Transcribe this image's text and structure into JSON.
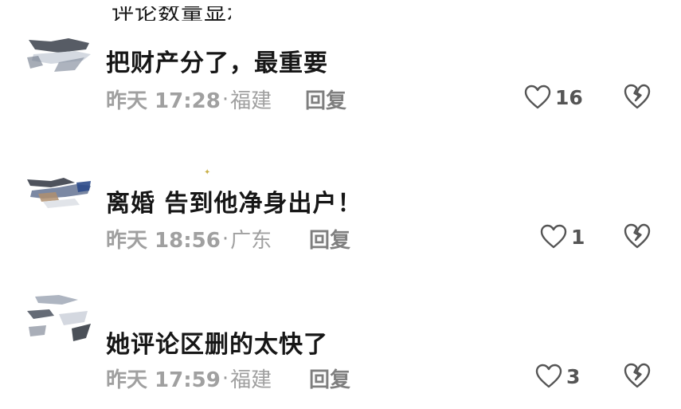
{
  "top_fragment": "评论数量显示",
  "comments": [
    {
      "text": "把财产分了，最重要",
      "time": "昨天 17:28",
      "region": "福建",
      "reply_label": "回复",
      "likes": "16"
    },
    {
      "text": "离婚 告到他净身出户！",
      "time": "昨天 18:56",
      "region": "广东",
      "reply_label": "回复",
      "likes": "1"
    },
    {
      "text": "她评论区删的太快了",
      "time": "昨天 17:59",
      "region": "福建",
      "reply_label": "回复",
      "likes": "3"
    }
  ],
  "icons": {
    "like": "heart-outline-icon",
    "dislike": "broken-heart-icon"
  },
  "colors": {
    "text_primary": "#161616",
    "text_meta": "#9a9a9a",
    "reply": "#7f7f7f",
    "icon": "#555555"
  }
}
